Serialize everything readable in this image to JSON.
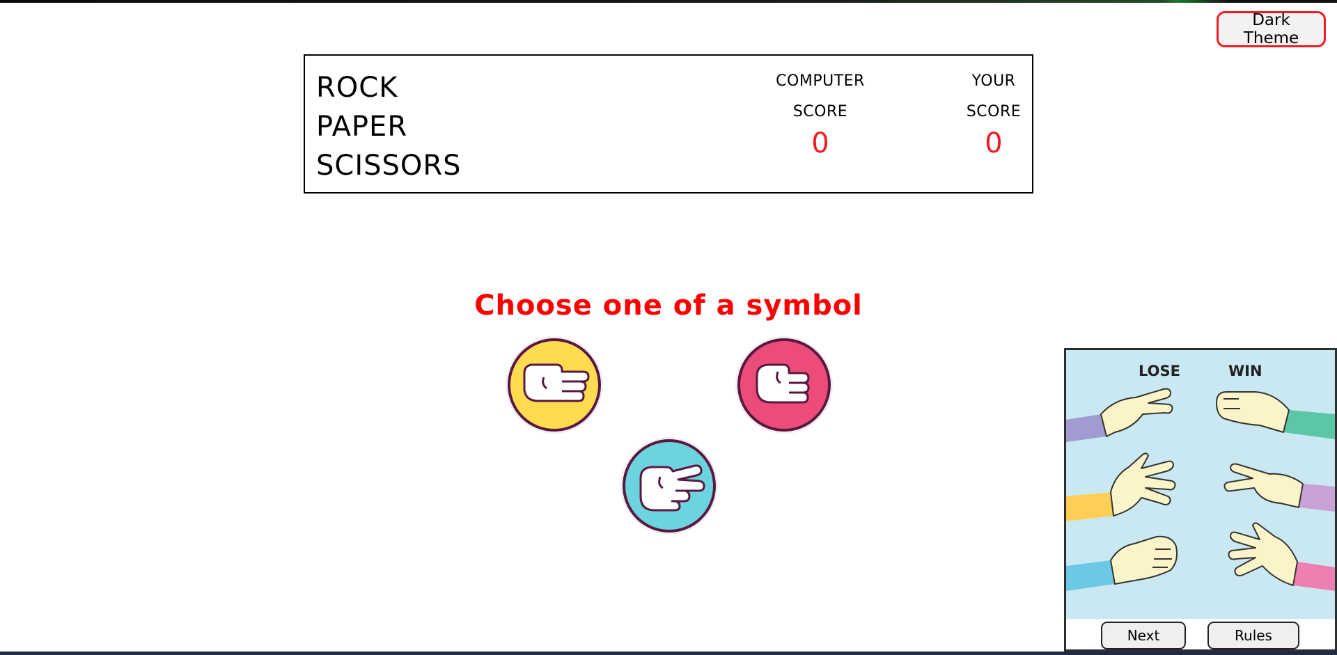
{
  "theme_button": {
    "label": "Dark Theme"
  },
  "scoreboard": {
    "title_lines": [
      "ROCK",
      "PAPER",
      "SCISSORS"
    ],
    "computer": {
      "label_line1": "COMPUTER",
      "label_line2": "SCORE",
      "value": "0"
    },
    "player": {
      "label_line1": "YOUR",
      "label_line2": "SCORE",
      "value": "0"
    }
  },
  "prompt": "Choose one of a symbol",
  "symbols": [
    {
      "name": "paper",
      "icon": "paper-hand-icon",
      "color": "#ffdb50"
    },
    {
      "name": "rock",
      "icon": "rock-fist-icon",
      "color": "#ec4c7a"
    },
    {
      "name": "scissors",
      "icon": "scissors-hand-icon",
      "color": "#6cd4de"
    }
  ],
  "rules_panel": {
    "lose_label": "LOSE",
    "win_label": "WIN",
    "next_label": "Next",
    "rules_label": "Rules"
  },
  "colors": {
    "accent_red": "#ef1c24",
    "symbol_border": "#5a1840",
    "rules_bg": "#c9e8f2"
  }
}
